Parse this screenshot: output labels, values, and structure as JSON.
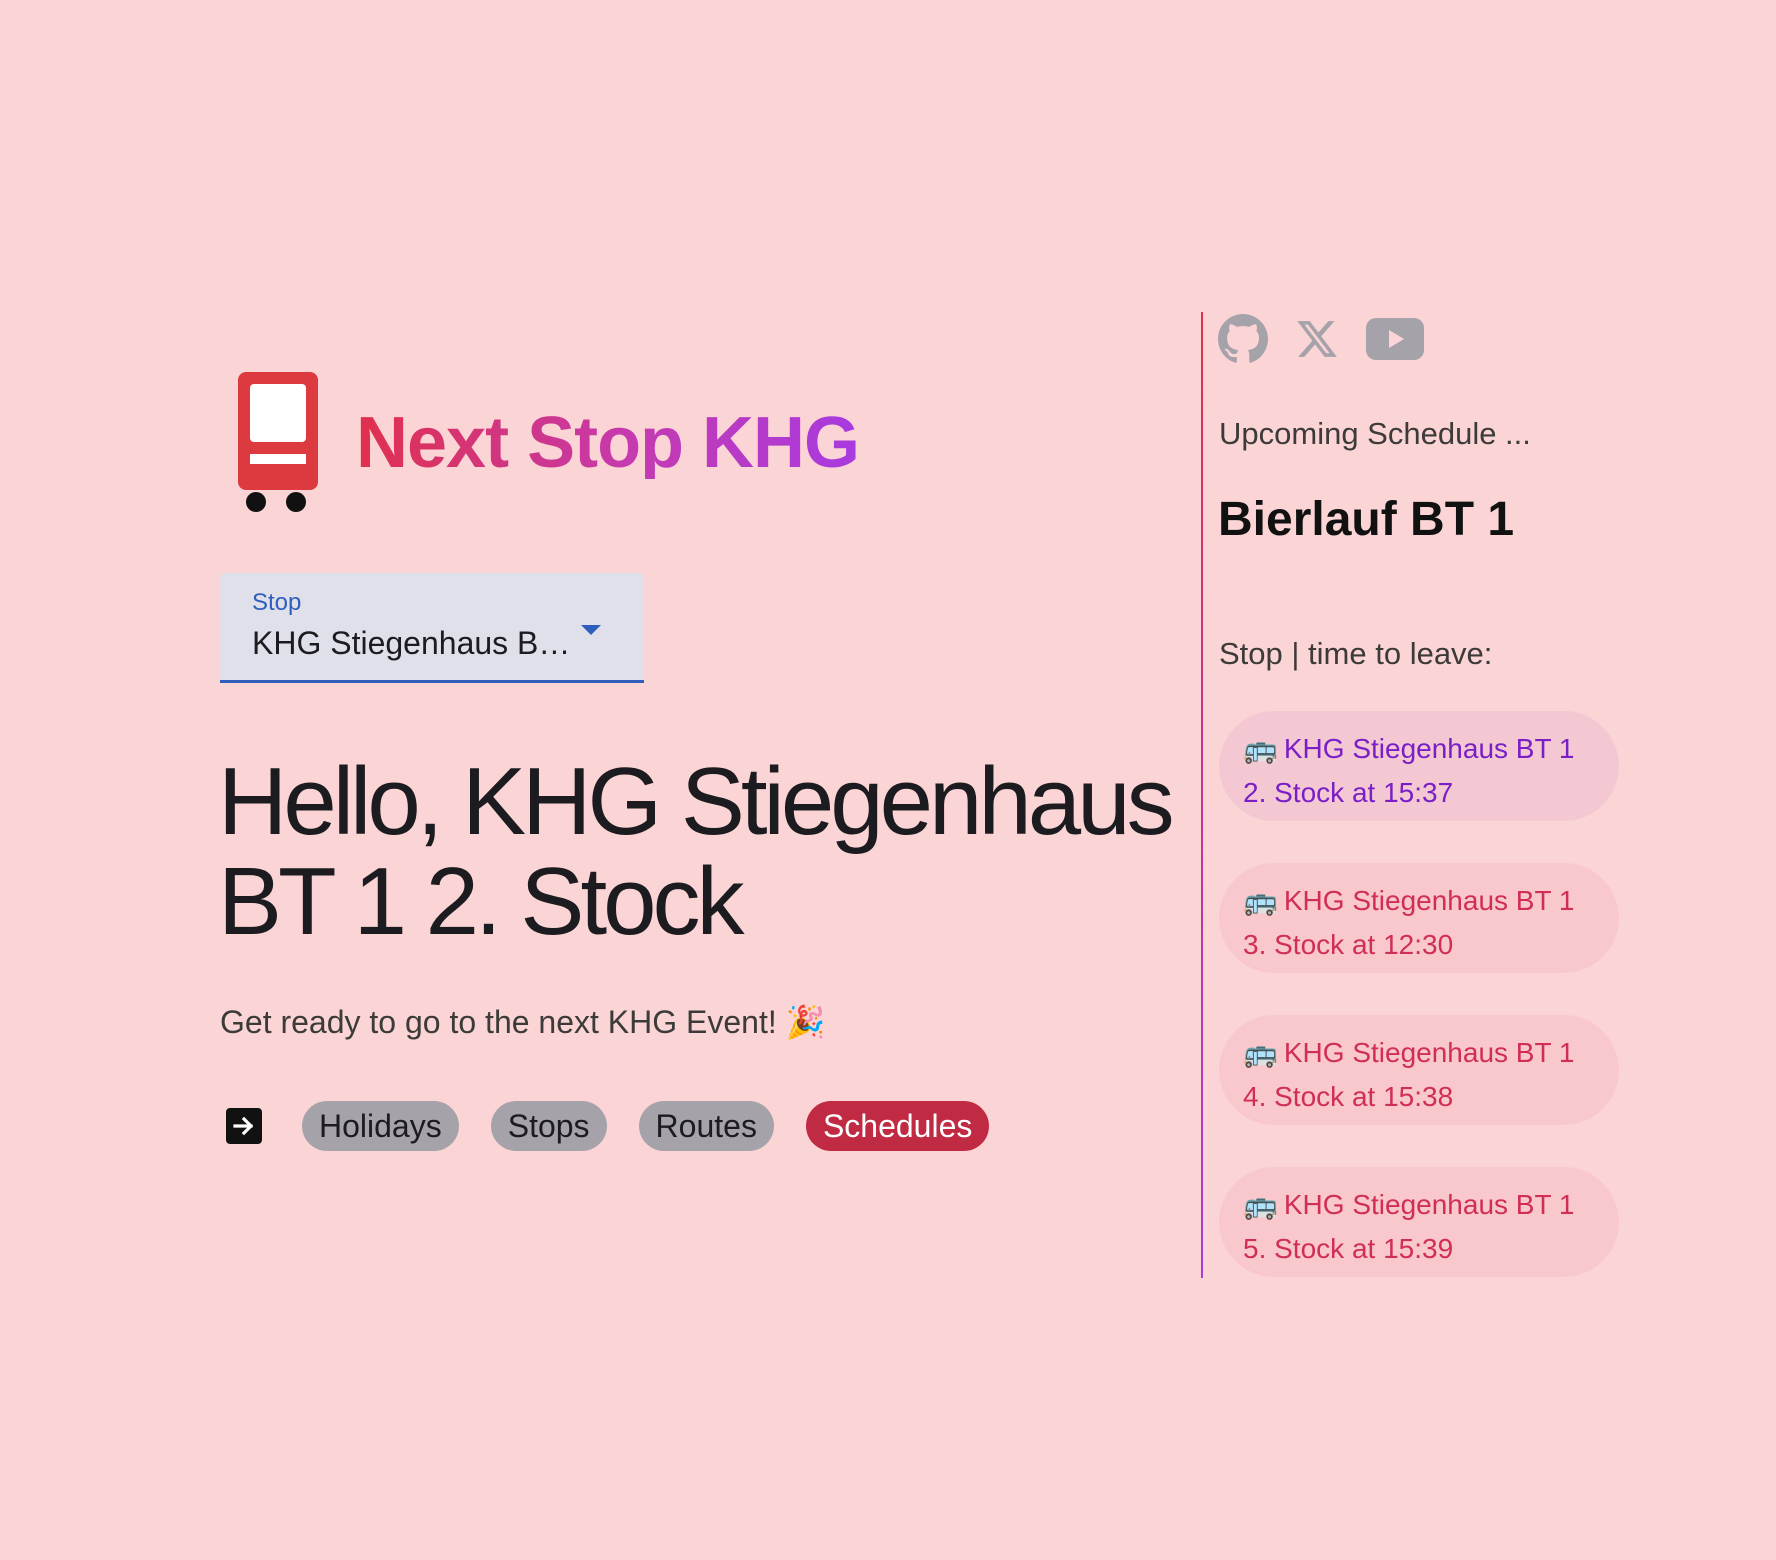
{
  "brand": {
    "title": "Next Stop KHG",
    "logo_icon": "bus-stop-sign-icon"
  },
  "stop_select": {
    "label": "Stop",
    "value": "KHG Stiegenhaus BT 1 2. Stock"
  },
  "hero": {
    "heading": "Hello, KHG Stiegenhaus BT 1 2. Stock",
    "subtitle": "Get ready to go to the next KHG Event! 🎉"
  },
  "nav": {
    "arrow_icon": "arrow-right-box-icon",
    "chips": [
      {
        "label": "Holidays",
        "active": false
      },
      {
        "label": "Stops",
        "active": false
      },
      {
        "label": "Routes",
        "active": false
      },
      {
        "label": "Schedules",
        "active": true
      }
    ]
  },
  "social": {
    "icons": [
      "github-icon",
      "x-icon",
      "youtube-icon"
    ],
    "icon_color": "#a6a2aa"
  },
  "sidebar": {
    "upcoming_label": "Upcoming Schedule ...",
    "event_title": "Bierlauf BT 1",
    "leave_label": "Stop | time to leave:",
    "items": [
      {
        "emoji": "🚌",
        "text": "KHG Stiegenhaus BT 1 2. Stock at 15:37",
        "selected": true
      },
      {
        "emoji": "🚌",
        "text": "KHG Stiegenhaus BT 1 3. Stock at 12:30",
        "selected": false
      },
      {
        "emoji": "🚌",
        "text": "KHG Stiegenhaus BT 1 4. Stock at 15:38",
        "selected": false
      },
      {
        "emoji": "🚌",
        "text": "KHG Stiegenhaus BT 1 5. Stock at 15:39",
        "selected": false
      }
    ]
  },
  "colors": {
    "background": "#fbd5d5",
    "accent_red": "#c02b43",
    "accent_purple": "#7a1fc7",
    "select_underline": "#2f5fbd"
  }
}
